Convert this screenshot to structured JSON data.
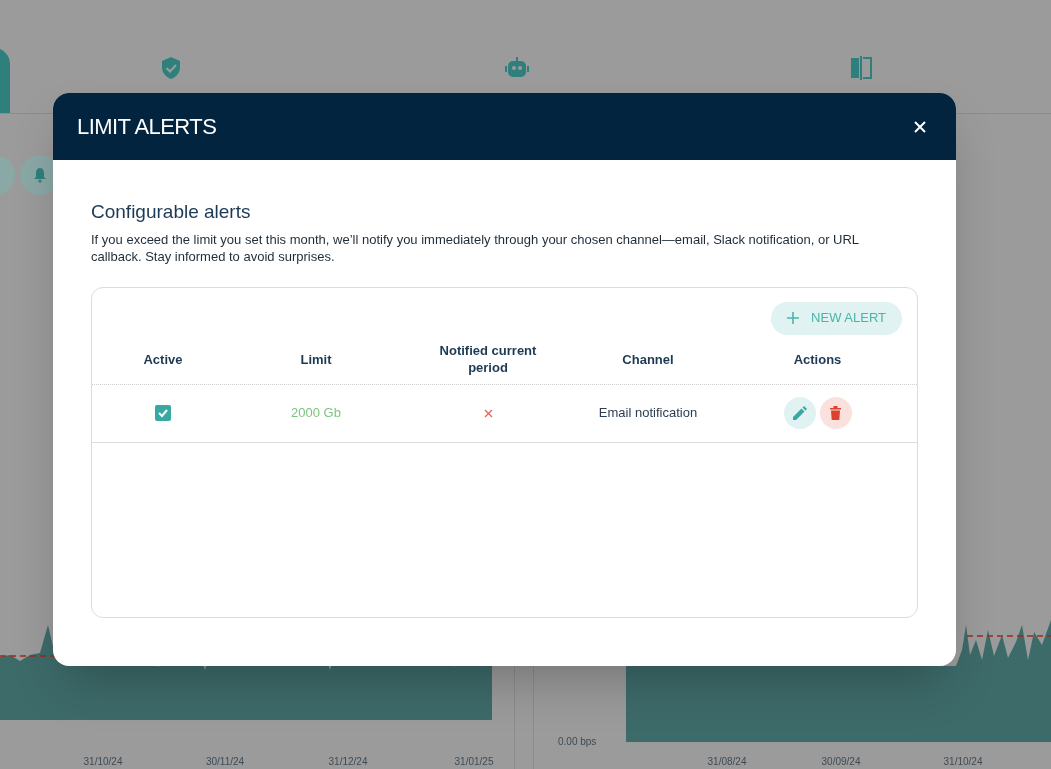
{
  "backdrop": {
    "tabs": [
      {
        "selected": true
      },
      {
        "kind": "shield",
        "selected": false
      },
      {
        "kind": "robot",
        "selected": false
      },
      {
        "kind": "split",
        "selected": false
      }
    ],
    "charts": [
      {
        "x_labels": [
          "31/10/24",
          "30/11/24",
          "31/12/24",
          "31/01/25"
        ]
      },
      {
        "y_labels": [
          "0.00 bps"
        ],
        "x_labels": [
          "31/08/24",
          "30/09/24",
          "31/10/24"
        ]
      }
    ]
  },
  "modal": {
    "title": "LIMIT ALERTS",
    "heading": "Configurable alerts",
    "description": "If you exceed the limit you set this month, we’ll notify you immediately through your chosen channel—email, Slack notification, or URL callback. Stay informed to avoid surprises.",
    "new_alert_button": "NEW ALERT",
    "columns": [
      "Active",
      "Limit",
      "Notified current period",
      "Channel",
      "Actions"
    ],
    "rows": [
      {
        "active": true,
        "limit": "2000 Gb",
        "notified": false,
        "channel": "Email notification"
      }
    ]
  }
}
